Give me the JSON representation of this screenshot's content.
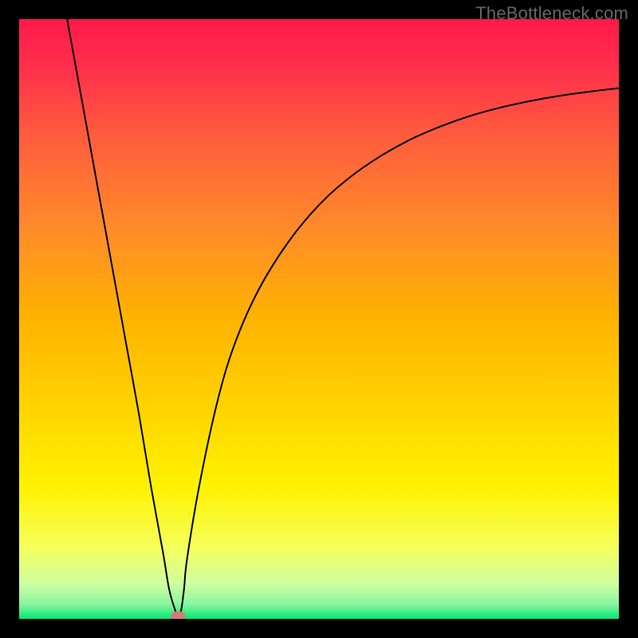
{
  "watermark": "TheBottleneck.com",
  "chart_data": {
    "type": "line",
    "title": "",
    "xlabel": "",
    "ylabel": "",
    "xlim": [
      0,
      100
    ],
    "ylim": [
      0,
      100
    ],
    "grid": false,
    "legend": false,
    "background_gradient_stops": [
      {
        "pos": 0.0,
        "color": "#ff1a4a"
      },
      {
        "pos": 0.08,
        "color": "#ff2f4c"
      },
      {
        "pos": 0.2,
        "color": "#ff5e3c"
      },
      {
        "pos": 0.35,
        "color": "#ff8b2a"
      },
      {
        "pos": 0.5,
        "color": "#ffb300"
      },
      {
        "pos": 0.65,
        "color": "#ffd400"
      },
      {
        "pos": 0.78,
        "color": "#fff200"
      },
      {
        "pos": 0.88,
        "color": "#f6ff5a"
      },
      {
        "pos": 0.94,
        "color": "#cfffa0"
      },
      {
        "pos": 0.975,
        "color": "#8cf59e"
      },
      {
        "pos": 1.0,
        "color": "#00e874"
      }
    ],
    "series": [
      {
        "name": "bottleneck-curve",
        "stroke": "#000000",
        "stroke_width": 2,
        "x": [
          8,
          10,
          12,
          14,
          16,
          18,
          20,
          22,
          24,
          25,
          26,
          26.5,
          27,
          27.5,
          28,
          30,
          33,
          36,
          40,
          45,
          50,
          55,
          60,
          65,
          70,
          75,
          80,
          85,
          90,
          95,
          100
        ],
        "y": [
          100,
          89,
          78,
          67,
          56,
          45,
          34,
          22,
          11,
          5,
          1.5,
          0.5,
          1.4,
          5,
          10,
          22,
          36,
          46,
          55,
          63,
          69,
          73.5,
          77,
          79.8,
          82,
          83.8,
          85.2,
          86.3,
          87.2,
          87.9,
          88.5
        ]
      }
    ],
    "marker": {
      "name": "optimum-point",
      "x": 26.5,
      "y": 0.5,
      "color": "#d97a7a",
      "rx": 9,
      "ry": 6
    }
  }
}
